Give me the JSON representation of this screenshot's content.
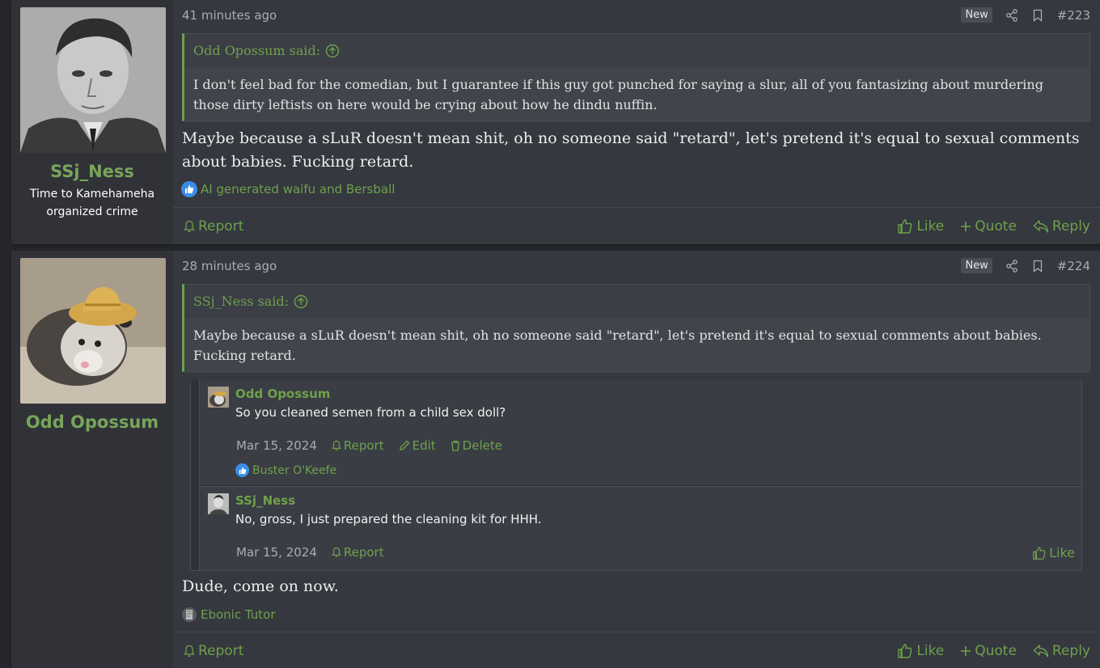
{
  "posts": [
    {
      "time": "41 minutes ago",
      "badge": "New",
      "number": "#223",
      "username": "SSj_Ness",
      "user_title_line1": "Time to Kamehameha",
      "user_title_line2": "organized crime",
      "quote_author": "Odd Opossum said:",
      "quote_text": "I don't feel bad for the comedian, but I guarantee if this guy got punched for saying a slur, all of you fantasizing about murdering those dirty leftists on here would be crying about how he dindu nuffin.",
      "body": "Maybe because a sLuR doesn't mean shit, oh no someone said \"retard\", let's pretend it's equal to sexual comments about babies. Fucking retard.",
      "reactions": "AI generated waifu and Bersball",
      "report": "Report",
      "like": "Like",
      "quote": "Quote",
      "reply": "Reply"
    },
    {
      "time": "28 minutes ago",
      "badge": "New",
      "number": "#224",
      "username": "Odd Opossum",
      "quote_author": "SSj_Ness said:",
      "quote_text": "Maybe because a sLuR doesn't mean shit, oh no someone said \"retard\", let's pretend it's equal to sexual comments about babies. Fucking retard.",
      "body": "Dude, come on now.",
      "reactions": "Ebonic Tutor",
      "report": "Report",
      "like": "Like",
      "quote": "Quote",
      "reply": "Reply",
      "comments": [
        {
          "user": "Odd Opossum",
          "text": "So you cleaned semen from a child sex doll?",
          "date": "Mar 15, 2024",
          "report": "Report",
          "edit": "Edit",
          "delete": "Delete",
          "reactions": "Buster O'Keefe"
        },
        {
          "user": "SSj_Ness",
          "text": "No, gross, I just prepared the cleaning kit for HHH.",
          "date": "Mar 15, 2024",
          "report": "Report",
          "like": "Like"
        }
      ]
    }
  ],
  "colors": {
    "accent": "#6ea14b",
    "background": "#25272c",
    "post": "#35383f",
    "reaction_blue": "#3a8ee8"
  }
}
